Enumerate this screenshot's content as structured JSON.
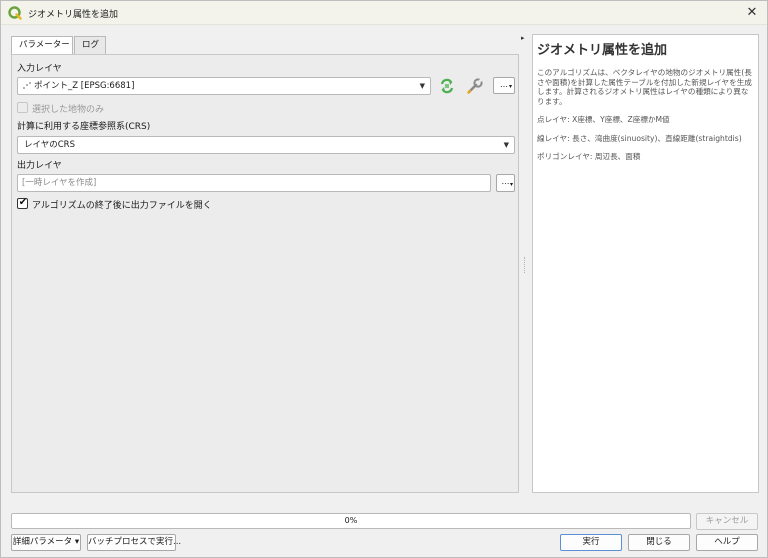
{
  "window": {
    "title": "ジオメトリ属性を追加",
    "close_glyph": "✕"
  },
  "tabs": [
    {
      "label": "パラメーター",
      "active": true
    },
    {
      "label": "ログ",
      "active": false
    }
  ],
  "params": {
    "input_layer_label": "入力レイヤ",
    "input_layer_value": "ポイント_Z [EPSG:6681]",
    "ellipsis": "…",
    "selected_only_label": "選択した地物のみ",
    "crs_label": "計算に利用する座標参照系(CRS)",
    "crs_value": "レイヤのCRS",
    "output_label": "出力レイヤ",
    "output_placeholder": "[一時レイヤを作成]",
    "open_output_label": "アルゴリズムの終了後に出力ファイルを開く",
    "open_output_checked": true,
    "dropdown_arrow": "▼"
  },
  "help": {
    "title": "ジオメトリ属性を追加",
    "description": "このアルゴリズムは、ベクタレイヤの地物のジオメトリ属性(長さや面積)を計算した属性テーブルを付加した新規レイヤを生成します。計算されるジオメトリ属性はレイヤの種類により異なります。",
    "point": "点レイヤ: X座標、Y座標、Z座標かM値",
    "line": "線レイヤ: 長さ、湾曲度(sinuosity)、直線距離(straightdis)",
    "polygon": "ポリゴンレイヤ: 周辺長、面積"
  },
  "progress": {
    "text": "0%",
    "value": 0
  },
  "buttons": {
    "cancel": "キャンセル",
    "advanced": "詳細パラメータ",
    "advanced_arrow": "▾",
    "batch": "バッチプロセスで実行...",
    "run": "実行",
    "close": "閉じる",
    "help": "ヘルプ"
  },
  "icons": {
    "app": "qgis-logo-icon",
    "iterate": "iterate-icon",
    "settings": "wrench-icon",
    "splitter": "splitter-arrow-icon"
  },
  "colors": {
    "accent": "#5b8fd6",
    "qgis_green": "#6aa33c",
    "iterate_green": "#4caf50"
  }
}
